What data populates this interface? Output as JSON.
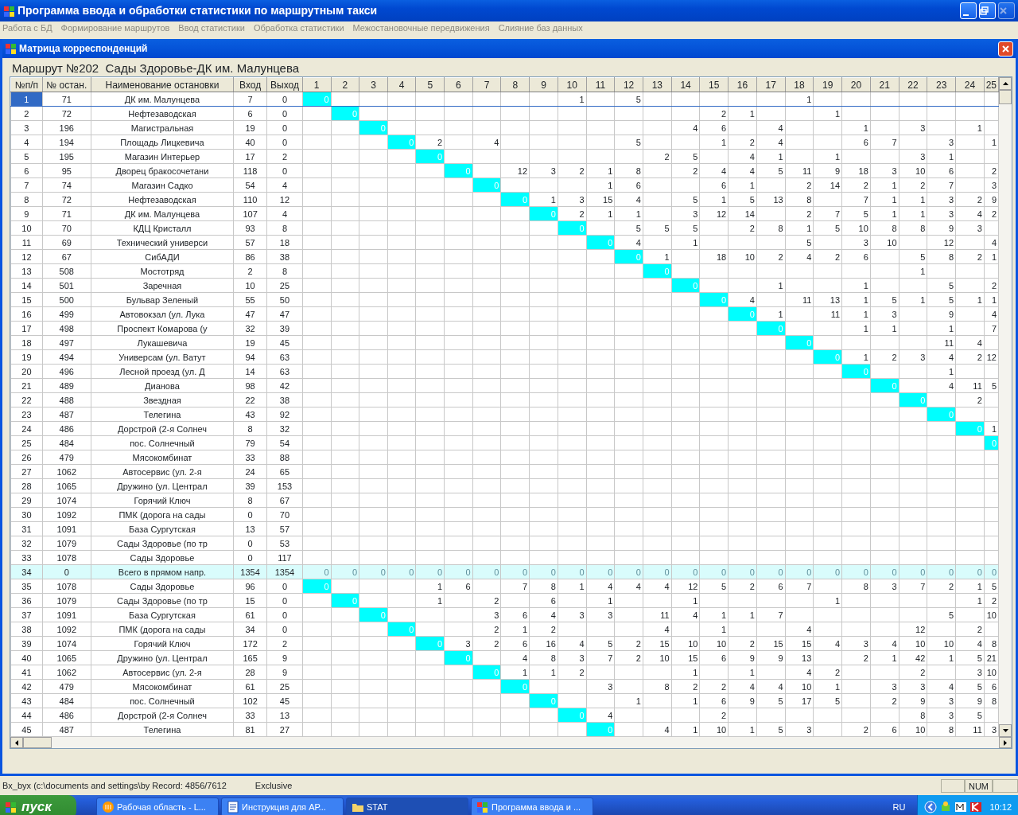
{
  "window": {
    "title": "Программа ввода и обработки статистики по маршрутным такси"
  },
  "menu": [
    {
      "label": "Работа с БД",
      "disabled": true
    },
    {
      "label": "Формирование маршрутов",
      "disabled": true
    },
    {
      "label": "Ввод статистики",
      "disabled": true
    },
    {
      "label": "Обработка статистики",
      "disabled": true
    },
    {
      "label": "Межостановочные передвижения",
      "disabled": true
    },
    {
      "label": "Слияние баз данных",
      "disabled": true
    }
  ],
  "child_window": {
    "title": "Матрица корреспонденций",
    "route": "Маршрут №202  Сады Здоровье-ДК им. Малунцева"
  },
  "table": {
    "columns": [
      "№п/п",
      "№ остан.",
      "Наименование остановки",
      "Вход",
      "Выход"
    ],
    "matrix_columns": [
      "1",
      "2",
      "3",
      "4",
      "5",
      "6",
      "7",
      "8",
      "9",
      "10",
      "11",
      "12",
      "13",
      "14",
      "15",
      "16",
      "17",
      "18",
      "19",
      "20",
      "21",
      "22",
      "23",
      "24",
      "25"
    ],
    "rows": [
      {
        "n": "1",
        "stop": "71",
        "name": "ДК им. Малунцева",
        "in": "7",
        "out": "0",
        "kind": "forward",
        "selected": true,
        "cells": {
          "c1": "0",
          "c10": "1",
          "c12": "5",
          "c18": "1"
        }
      },
      {
        "n": "2",
        "stop": "72",
        "name": "Нефтезаводская",
        "in": "6",
        "out": "0",
        "kind": "forward",
        "selected": false,
        "cells": {
          "c2": "0",
          "c15": "2",
          "c16": "1",
          "c19": "1"
        }
      },
      {
        "n": "3",
        "stop": "196",
        "name": "Магистральная",
        "in": "19",
        "out": "0",
        "kind": "forward",
        "selected": false,
        "cells": {
          "c3": "0",
          "c14": "4",
          "c15": "6",
          "c17": "4",
          "c20": "1",
          "c22": "3",
          "c24": "1"
        }
      },
      {
        "n": "4",
        "stop": "194",
        "name": "Площадь Лицкевича",
        "in": "40",
        "out": "0",
        "kind": "forward",
        "selected": false,
        "cells": {
          "c4": "0",
          "c5": "2",
          "c7": "4",
          "c12": "5",
          "c15": "1",
          "c16": "2",
          "c17": "4",
          "c20": "6",
          "c21": "7",
          "c23": "3",
          "c25": "1"
        }
      },
      {
        "n": "5",
        "stop": "195",
        "name": "Магазин Интерьер",
        "in": "17",
        "out": "2",
        "kind": "forward",
        "selected": false,
        "cells": {
          "c5": "0",
          "c13": "2",
          "c14": "5",
          "c16": "4",
          "c17": "1",
          "c19": "1",
          "c22": "3",
          "c23": "1"
        }
      },
      {
        "n": "6",
        "stop": "95",
        "name": "Дворец бракосочетани",
        "in": "118",
        "out": "0",
        "kind": "forward",
        "selected": false,
        "cells": {
          "c6": "0",
          "c8": "12",
          "c9": "3",
          "c10": "2",
          "c11": "1",
          "c12": "8",
          "c14": "2",
          "c15": "4",
          "c16": "4",
          "c17": "5",
          "c18": "11",
          "c19": "9",
          "c20": "18",
          "c21": "3",
          "c22": "10",
          "c23": "6",
          "c25": "2"
        }
      },
      {
        "n": "7",
        "stop": "74",
        "name": "Магазин Садко",
        "in": "54",
        "out": "4",
        "kind": "forward",
        "selected": false,
        "cells": {
          "c7": "0",
          "c11": "1",
          "c12": "6",
          "c15": "6",
          "c16": "1",
          "c18": "2",
          "c19": "14",
          "c20": "2",
          "c21": "1",
          "c22": "2",
          "c23": "7",
          "c25": "3"
        }
      },
      {
        "n": "8",
        "stop": "72",
        "name": "Нефтезаводская",
        "in": "110",
        "out": "12",
        "kind": "forward",
        "selected": false,
        "cells": {
          "c8": "0",
          "c9": "1",
          "c10": "3",
          "c11": "15",
          "c12": "4",
          "c14": "5",
          "c15": "1",
          "c16": "5",
          "c17": "13",
          "c18": "8",
          "c20": "7",
          "c21": "1",
          "c22": "1",
          "c23": "3",
          "c24": "2",
          "c25": "9"
        }
      },
      {
        "n": "9",
        "stop": "71",
        "name": "ДК им. Малунцева",
        "in": "107",
        "out": "4",
        "kind": "forward",
        "selected": false,
        "cells": {
          "c9": "0",
          "c10": "2",
          "c11": "1",
          "c12": "1",
          "c14": "3",
          "c15": "12",
          "c16": "14",
          "c18": "2",
          "c19": "7",
          "c20": "5",
          "c21": "1",
          "c22": "1",
          "c23": "3",
          "c24": "4",
          "c25": "2"
        }
      },
      {
        "n": "10",
        "stop": "70",
        "name": "КДЦ Кристалл",
        "in": "93",
        "out": "8",
        "kind": "forward",
        "selected": false,
        "cells": {
          "c10": "0",
          "c12": "5",
          "c13": "5",
          "c14": "5",
          "c16": "2",
          "c17": "8",
          "c18": "1",
          "c19": "5",
          "c20": "10",
          "c21": "8",
          "c22": "8",
          "c23": "9",
          "c24": "3"
        }
      },
      {
        "n": "11",
        "stop": "69",
        "name": "Технический универси",
        "in": "57",
        "out": "18",
        "kind": "forward",
        "selected": false,
        "cells": {
          "c11": "0",
          "c12": "4",
          "c14": "1",
          "c18": "5",
          "c20": "3",
          "c21": "10",
          "c23": "12",
          "c25": "4"
        }
      },
      {
        "n": "12",
        "stop": "67",
        "name": "СибАДИ",
        "in": "86",
        "out": "38",
        "kind": "forward",
        "selected": false,
        "cells": {
          "c12": "0",
          "c13": "1",
          "c15": "18",
          "c16": "10",
          "c17": "2",
          "c18": "4",
          "c19": "2",
          "c20": "6",
          "c22": "5",
          "c23": "8",
          "c24": "2",
          "c25": "1"
        }
      },
      {
        "n": "13",
        "stop": "508",
        "name": "Мостотряд",
        "in": "2",
        "out": "8",
        "kind": "forward",
        "selected": false,
        "cells": {
          "c13": "0",
          "c22": "1"
        }
      },
      {
        "n": "14",
        "stop": "501",
        "name": "Заречная",
        "in": "10",
        "out": "25",
        "kind": "forward",
        "selected": false,
        "cells": {
          "c14": "0",
          "c17": "1",
          "c20": "1",
          "c23": "5",
          "c25": "2"
        }
      },
      {
        "n": "15",
        "stop": "500",
        "name": "Бульвар Зеленый",
        "in": "55",
        "out": "50",
        "kind": "forward",
        "selected": false,
        "cells": {
          "c15": "0",
          "c16": "4",
          "c18": "11",
          "c19": "13",
          "c20": "1",
          "c21": "5",
          "c22": "1",
          "c23": "5",
          "c24": "1",
          "c25": "1"
        }
      },
      {
        "n": "16",
        "stop": "499",
        "name": "Автовокзал (ул. Лука",
        "in": "47",
        "out": "47",
        "kind": "forward",
        "selected": false,
        "cells": {
          "c16": "0",
          "c17": "1",
          "c19": "11",
          "c20": "1",
          "c21": "3",
          "c23": "9",
          "c25": "4"
        }
      },
      {
        "n": "17",
        "stop": "498",
        "name": "Проспект Комарова (у",
        "in": "32",
        "out": "39",
        "kind": "forward",
        "selected": false,
        "cells": {
          "c17": "0",
          "c20": "1",
          "c21": "1",
          "c23": "1",
          "c25": "7"
        }
      },
      {
        "n": "18",
        "stop": "497",
        "name": "Лукашевича",
        "in": "19",
        "out": "45",
        "kind": "forward",
        "selected": false,
        "cells": {
          "c18": "0",
          "c23": "11",
          "c24": "4"
        }
      },
      {
        "n": "19",
        "stop": "494",
        "name": "Универсам (ул. Ватут",
        "in": "94",
        "out": "63",
        "kind": "forward",
        "selected": false,
        "cells": {
          "c19": "0",
          "c20": "1",
          "c21": "2",
          "c22": "3",
          "c23": "4",
          "c24": "2",
          "c25": "12"
        }
      },
      {
        "n": "20",
        "stop": "496",
        "name": "Лесной проезд (ул. Д",
        "in": "14",
        "out": "63",
        "kind": "forward",
        "selected": false,
        "cells": {
          "c20": "0",
          "c23": "1"
        }
      },
      {
        "n": "21",
        "stop": "489",
        "name": "Дианова",
        "in": "98",
        "out": "42",
        "kind": "forward",
        "selected": false,
        "cells": {
          "c21": "0",
          "c23": "4",
          "c24": "11",
          "c25": "5"
        }
      },
      {
        "n": "22",
        "stop": "488",
        "name": "Звездная",
        "in": "22",
        "out": "38",
        "kind": "forward",
        "selected": false,
        "cells": {
          "c22": "0",
          "c24": "2"
        }
      },
      {
        "n": "23",
        "stop": "487",
        "name": "Телегина",
        "in": "43",
        "out": "92",
        "kind": "forward",
        "selected": false,
        "cells": {
          "c23": "0"
        }
      },
      {
        "n": "24",
        "stop": "486",
        "name": "Дорстрой (2-я Солнеч",
        "in": "8",
        "out": "32",
        "kind": "forward",
        "selected": false,
        "cells": {
          "c24": "0",
          "c25": "1"
        }
      },
      {
        "n": "25",
        "stop": "484",
        "name": "пос. Солнечный",
        "in": "79",
        "out": "54",
        "kind": "forward",
        "selected": false,
        "cells": {
          "c25": "0"
        }
      },
      {
        "n": "26",
        "stop": "479",
        "name": "Мясокомбинат",
        "in": "33",
        "out": "88",
        "kind": "forward",
        "selected": false
      },
      {
        "n": "27",
        "stop": "1062",
        "name": "Автосервис (ул. 2-я",
        "in": "24",
        "out": "65",
        "kind": "forward",
        "selected": false
      },
      {
        "n": "28",
        "stop": "1065",
        "name": "Дружино (ул. Централ",
        "in": "39",
        "out": "153",
        "kind": "forward",
        "selected": false
      },
      {
        "n": "29",
        "stop": "1074",
        "name": "Горячий Ключ",
        "in": "8",
        "out": "67",
        "kind": "forward",
        "selected": false
      },
      {
        "n": "30",
        "stop": "1092",
        "name": "ПМК (дорога на сады",
        "in": "0",
        "out": "70",
        "kind": "forward",
        "selected": false
      },
      {
        "n": "31",
        "stop": "1091",
        "name": "База Сургутская",
        "in": "13",
        "out": "57",
        "kind": "forward",
        "selected": false
      },
      {
        "n": "32",
        "stop": "1079",
        "name": "Сады Здоровье (по тр",
        "in": "0",
        "out": "53",
        "kind": "forward",
        "selected": false
      },
      {
        "n": "33",
        "stop": "1078",
        "name": "Сады Здоровье",
        "in": "0",
        "out": "117",
        "kind": "forward",
        "selected": false
      },
      {
        "n": "34",
        "stop": "0",
        "name": "Всего в прямом напр.",
        "in": "1354",
        "out": "1354",
        "kind": "total",
        "selected": false,
        "cells": {
          "c1": "0",
          "c2": "0",
          "c3": "0",
          "c4": "0",
          "c5": "0",
          "c6": "0",
          "c7": "0",
          "c8": "0",
          "c9": "0",
          "c10": "0",
          "c11": "0",
          "c12": "0",
          "c13": "0",
          "c14": "0",
          "c15": "0",
          "c16": "0",
          "c17": "0",
          "c18": "0",
          "c19": "0",
          "c20": "0",
          "c21": "0",
          "c22": "0",
          "c23": "0",
          "c24": "0",
          "c25": "0"
        }
      },
      {
        "n": "35",
        "stop": "1078",
        "name": "Сады Здоровье",
        "in": "96",
        "out": "0",
        "kind": "return",
        "selected": false,
        "cells": {
          "c1": "0",
          "c5": "1",
          "c6": "6",
          "c8": "7",
          "c9": "8",
          "c10": "1",
          "c11": "4",
          "c12": "4",
          "c13": "4",
          "c14": "12",
          "c15": "5",
          "c16": "2",
          "c17": "6",
          "c18": "7",
          "c20": "8",
          "c21": "3",
          "c22": "7",
          "c23": "2",
          "c24": "1",
          "c25": "5"
        }
      },
      {
        "n": "36",
        "stop": "1079",
        "name": "Сады Здоровье (по тр",
        "in": "15",
        "out": "0",
        "kind": "return",
        "selected": false,
        "cells": {
          "c2": "0",
          "c5": "1",
          "c7": "2",
          "c9": "6",
          "c11": "1",
          "c14": "1",
          "c19": "1",
          "c24": "1",
          "c25": "2"
        }
      },
      {
        "n": "37",
        "stop": "1091",
        "name": "База Сургутская",
        "in": "61",
        "out": "0",
        "kind": "return",
        "selected": false,
        "cells": {
          "c3": "0",
          "c7": "3",
          "c8": "6",
          "c9": "4",
          "c10": "3",
          "c11": "3",
          "c13": "11",
          "c14": "4",
          "c15": "1",
          "c16": "1",
          "c17": "7",
          "c23": "5",
          "c25": "10"
        }
      },
      {
        "n": "38",
        "stop": "1092",
        "name": "ПМК (дорога на сады",
        "in": "34",
        "out": "0",
        "kind": "return",
        "selected": false,
        "cells": {
          "c4": "0",
          "c7": "2",
          "c8": "1",
          "c9": "2",
          "c13": "4",
          "c15": "1",
          "c18": "4",
          "c22": "12",
          "c24": "2"
        }
      },
      {
        "n": "39",
        "stop": "1074",
        "name": "Горячий Ключ",
        "in": "172",
        "out": "2",
        "kind": "return",
        "selected": false,
        "cells": {
          "c5": "0",
          "c6": "3",
          "c7": "2",
          "c8": "6",
          "c9": "16",
          "c10": "4",
          "c11": "5",
          "c12": "2",
          "c13": "15",
          "c14": "10",
          "c15": "10",
          "c16": "2",
          "c17": "15",
          "c18": "15",
          "c19": "4",
          "c20": "3",
          "c21": "4",
          "c22": "10",
          "c23": "10",
          "c24": "4",
          "c25": "8"
        }
      },
      {
        "n": "40",
        "stop": "1065",
        "name": "Дружино (ул. Централ",
        "in": "165",
        "out": "9",
        "kind": "return",
        "selected": false,
        "cells": {
          "c6": "0",
          "c8": "4",
          "c9": "8",
          "c10": "3",
          "c11": "7",
          "c12": "2",
          "c13": "10",
          "c14": "15",
          "c15": "6",
          "c16": "9",
          "c17": "9",
          "c18": "13",
          "c20": "2",
          "c21": "1",
          "c22": "42",
          "c23": "1",
          "c24": "5",
          "c25": "21"
        }
      },
      {
        "n": "41",
        "stop": "1062",
        "name": "Автосервис (ул. 2-я",
        "in": "28",
        "out": "9",
        "kind": "return",
        "selected": false,
        "cells": {
          "c7": "0",
          "c8": "1",
          "c9": "1",
          "c10": "2",
          "c14": "1",
          "c16": "1",
          "c18": "4",
          "c19": "2",
          "c22": "2",
          "c24": "3",
          "c25": "10"
        }
      },
      {
        "n": "42",
        "stop": "479",
        "name": "Мясокомбинат",
        "in": "61",
        "out": "25",
        "kind": "return",
        "selected": false,
        "cells": {
          "c8": "0",
          "c11": "3",
          "c13": "8",
          "c14": "2",
          "c15": "2",
          "c16": "4",
          "c17": "4",
          "c18": "10",
          "c19": "1",
          "c21": "3",
          "c22": "3",
          "c23": "4",
          "c24": "5",
          "c25": "6"
        }
      },
      {
        "n": "43",
        "stop": "484",
        "name": "пос. Солнечный",
        "in": "102",
        "out": "45",
        "kind": "return",
        "selected": false,
        "cells": {
          "c9": "0",
          "c12": "1",
          "c14": "1",
          "c15": "6",
          "c16": "9",
          "c17": "5",
          "c18": "17",
          "c19": "5",
          "c21": "2",
          "c22": "9",
          "c23": "3",
          "c24": "9",
          "c25": "8"
        }
      },
      {
        "n": "44",
        "stop": "486",
        "name": "Дорстрой (2-я Солнеч",
        "in": "33",
        "out": "13",
        "kind": "return",
        "selected": false,
        "cells": {
          "c10": "0",
          "c11": "4",
          "c15": "2",
          "c22": "8",
          "c23": "3",
          "c24": "5"
        }
      },
      {
        "n": "45",
        "stop": "487",
        "name": "Телегина",
        "in": "81",
        "out": "27",
        "kind": "return",
        "selected": false,
        "cells": {
          "c11": "0",
          "c13": "4",
          "c14": "1",
          "c15": "10",
          "c16": "1",
          "c17": "5",
          "c18": "3",
          "c20": "2",
          "c21": "6",
          "c22": "10",
          "c23": "8",
          "c24": "11",
          "c25": "3"
        }
      }
    ]
  },
  "status_bar": {
    "panels": [
      "Bx_byx (c:\\documents and settings\\by",
      "Record: 4856/7612",
      "Exclusive",
      "NUM"
    ]
  },
  "taskbar": {
    "start": "пуск",
    "buttons": [
      {
        "label": "Рабочая область - L...",
        "selected": false
      },
      {
        "label": "Инструкция для АР...",
        "selected": false
      },
      {
        "label": "STAT",
        "selected": true
      },
      {
        "label": "Программа ввода и ...",
        "selected": false
      }
    ],
    "language": "RU",
    "clock": "10:12"
  }
}
